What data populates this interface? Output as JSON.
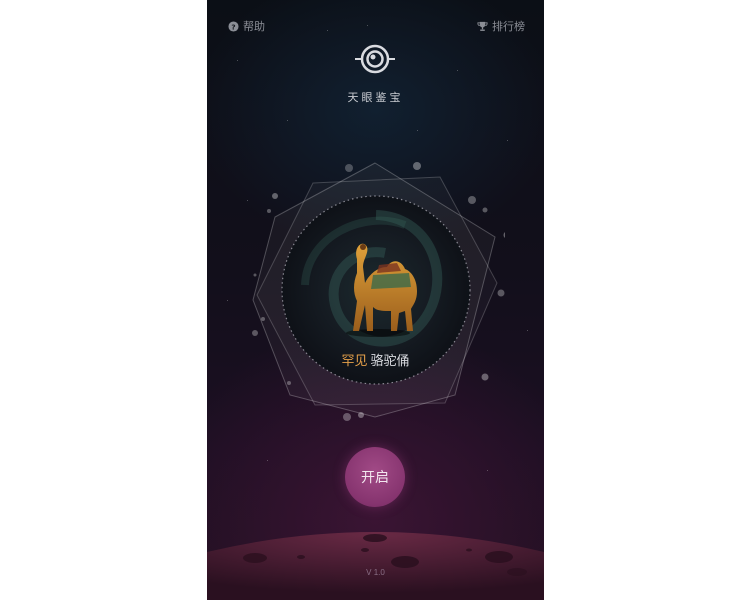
{
  "topbar": {
    "help_label": "帮助",
    "help_icon": "question-circle-icon",
    "rank_label": "排行榜",
    "rank_icon": "trophy-icon"
  },
  "app": {
    "logo_icon": "eye-icon",
    "title": "天眼鉴宝"
  },
  "emblem": {
    "rarity": "罕见",
    "item_name": "骆驼俑",
    "item_image": "tang-sancai-camel-figurine"
  },
  "actions": {
    "start_label": "开启"
  },
  "footer": {
    "version": "V 1.0"
  },
  "colors": {
    "rarity_accent": "#e6a14a",
    "button": "#86346f",
    "background_top": "#0b0f16",
    "background_bottom": "#221020"
  }
}
